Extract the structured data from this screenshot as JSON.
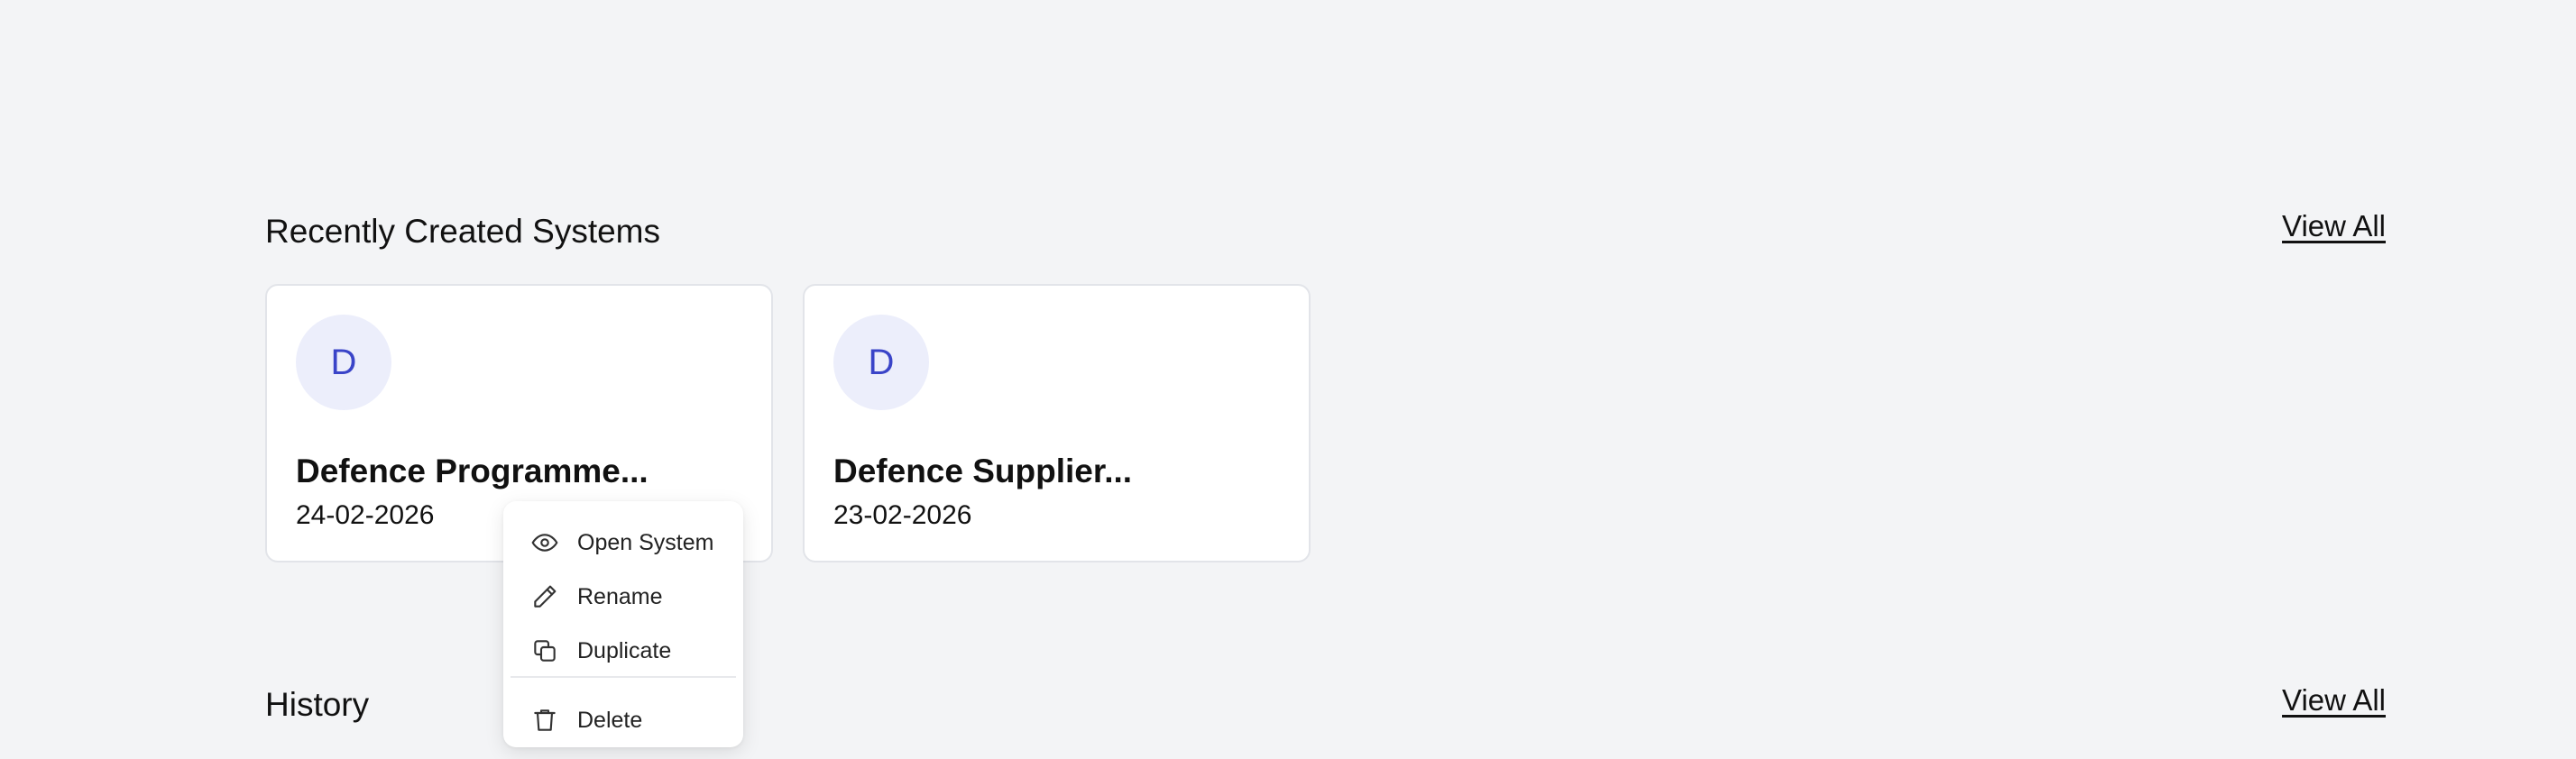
{
  "recent": {
    "title": "Recently Created Systems",
    "view_all": "View All",
    "cards": [
      {
        "initial": "D",
        "name": "Defence Programme...",
        "date": "24-02-2026"
      },
      {
        "initial": "D",
        "name": "Defence Supplier...",
        "date": "23-02-2026"
      }
    ]
  },
  "context_menu": {
    "items": [
      {
        "label": "Open System",
        "icon": "eye-icon"
      },
      {
        "label": "Rename",
        "icon": "pencil-icon"
      },
      {
        "label": "Duplicate",
        "icon": "copy-icon"
      },
      {
        "label": "Delete",
        "icon": "trash-icon"
      }
    ]
  },
  "history": {
    "title": "History",
    "view_all": "View All"
  },
  "colors": {
    "background": "#f3f4f6",
    "card": "#ffffff",
    "avatar_bg": "#eceefb",
    "avatar_text": "#3a44c8"
  }
}
